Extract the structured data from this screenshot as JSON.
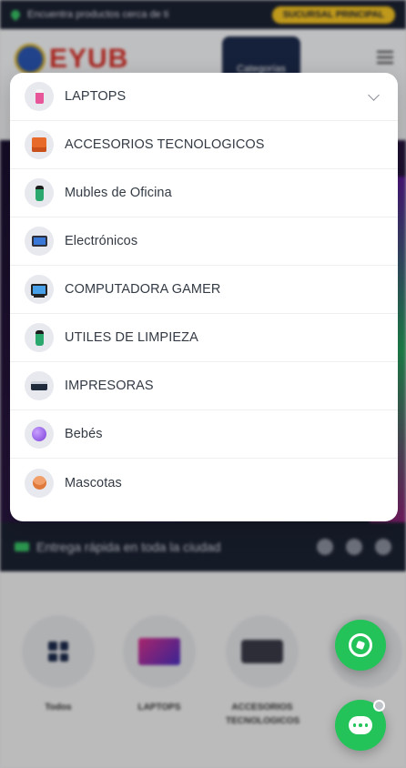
{
  "topbar": {
    "location_text": "Encuentra productos cerca de ti",
    "branch_button": "SUCURSAL PRINCIPAL"
  },
  "header": {
    "logo_text": "EYUB",
    "categories_button": "Categorías"
  },
  "delivery_bar": {
    "text": "Entrega rápida en toda la ciudad"
  },
  "category_carousel": [
    {
      "label": "Todos",
      "icon": "grid-icon"
    },
    {
      "label": "LAPTOPS",
      "icon": "laptop-icon"
    },
    {
      "label": "ACCESORIOS TECNOLOGICOS",
      "icon": "accessories-icon"
    }
  ],
  "dropdown": {
    "items": [
      {
        "label": "LAPTOPS",
        "icon": "pink-bottle-icon",
        "expanded": true
      },
      {
        "label": "ACCESORIOS TECNOLOGICOS",
        "icon": "orange-box-icon"
      },
      {
        "label": "Mubles de Oficina",
        "icon": "green-bottle-icon"
      },
      {
        "label": "Electrónicos",
        "icon": "monitor-icon"
      },
      {
        "label": "COMPUTADORA GAMER",
        "icon": "desktop-computer-icon"
      },
      {
        "label": "UTILES DE LIMPIEZA",
        "icon": "cleaning-bottle-icon"
      },
      {
        "label": "IMPRESORAS",
        "icon": "printer-icon"
      },
      {
        "label": "Bebés",
        "icon": "baby-toy-icon"
      },
      {
        "label": "Mascotas",
        "icon": "pet-icon"
      }
    ]
  },
  "colors": {
    "accent_green": "#23c35a",
    "navy": "#1c2233",
    "brand_red": "#d7312a",
    "branch_yellow": "#f5c423"
  }
}
